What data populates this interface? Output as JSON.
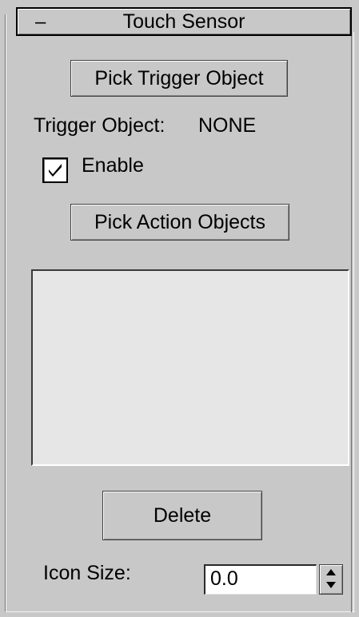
{
  "rollout": {
    "collapse_symbol": "–",
    "title": "Touch Sensor"
  },
  "buttons": {
    "pick_trigger": "Pick Trigger Object",
    "pick_action": "Pick Action Objects",
    "delete": "Delete"
  },
  "trigger": {
    "label": "Trigger Object:",
    "value": "NONE"
  },
  "enable": {
    "label": "Enable",
    "checked": true
  },
  "action_objects": [],
  "icon_size": {
    "label": "Icon Size:",
    "value": "0.0"
  },
  "icons": {
    "checkmark": "checkmark-icon",
    "spin_up": "arrow-up-icon",
    "spin_down": "arrow-down-icon"
  }
}
